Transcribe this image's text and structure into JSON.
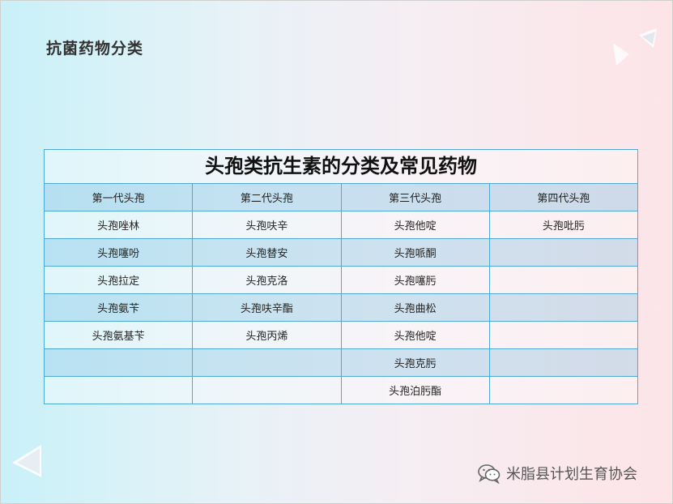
{
  "slide": {
    "title": "抗菌药物分类"
  },
  "table": {
    "caption": "头孢类抗生素的分类及常见药物",
    "headers": [
      "第一代头孢",
      "第二代头孢",
      "第三代头孢",
      "第四代头孢"
    ],
    "rows": [
      [
        "头孢唑林",
        "头孢呋辛",
        "头孢他啶",
        "头孢吡肟"
      ],
      [
        "头孢噻吩",
        "头孢替安",
        "头孢哌酮",
        ""
      ],
      [
        "头孢拉定",
        "头孢克洛",
        "头孢噻肟",
        ""
      ],
      [
        "头孢氨苄",
        "头孢呋辛酯",
        "头孢曲松",
        ""
      ],
      [
        "头孢氨基苄",
        "头孢丙烯",
        "头孢他啶",
        ""
      ],
      [
        "",
        "",
        "头孢克肟",
        ""
      ],
      [
        "",
        "",
        "头孢泊肟酯",
        ""
      ]
    ]
  },
  "watermark": {
    "text": "米脂县计划生育协会",
    "icon": "wechat-icon"
  },
  "colors": {
    "border": "#4fa8d8",
    "header_bg": "#bfe3f2",
    "bg_left": "#c9f1f8",
    "bg_right": "#fde4e7"
  }
}
